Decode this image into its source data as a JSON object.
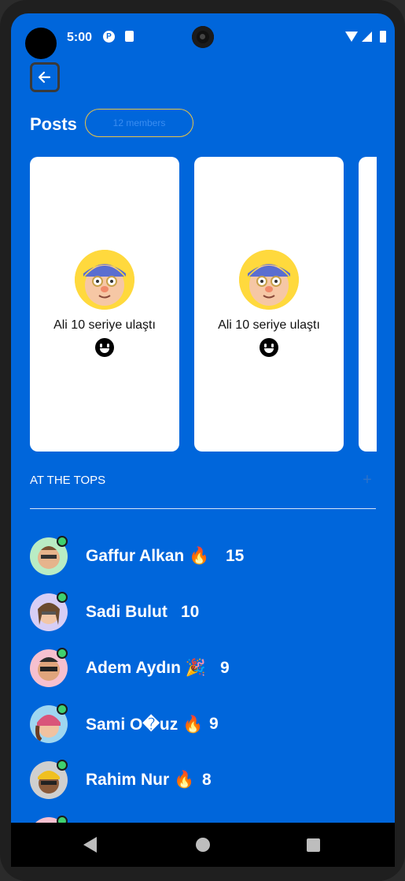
{
  "status": {
    "time": "5:00",
    "icons": [
      "notification-icon",
      "sd-card-icon",
      "camera",
      "wifi-icon",
      "signal-icon",
      "battery-icon"
    ]
  },
  "header": {
    "back_icon": "arrow-left-icon",
    "title": "Posts",
    "members": "12 members"
  },
  "posts": [
    {
      "caption": "Ali 10 seriye ulaştı",
      "emoji": "😀"
    },
    {
      "caption": "Ali 10 seriye ulaştı",
      "emoji": "😀"
    }
  ],
  "tops": {
    "label": "AT THE TOPS",
    "add_icon": "plus-icon"
  },
  "leaderboard": [
    {
      "name": "Gaffur Alkan 🔥",
      "score": "15"
    },
    {
      "name": "Sadi Bulut",
      "score": "10"
    },
    {
      "name": "Adem Aydın 🎉",
      "score": "9"
    },
    {
      "name": "Sami O�uz 🔥",
      "score": "9"
    },
    {
      "name": "Rahim Nur 🔥",
      "score": "8"
    }
  ],
  "colors": {
    "background": "#0066DB",
    "accent_border": "#E8C547",
    "online": "#3fd16f"
  }
}
